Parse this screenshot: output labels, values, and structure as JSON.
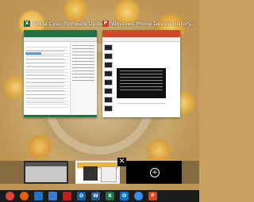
{
  "windows": [
    {
      "title": "Nokia Cyan Firmware Update I...",
      "app_icon": "excel-icon",
      "badge": "X",
      "color": "#217346"
    },
    {
      "title": "Windows Phone Device History...",
      "app_icon": "powerpoint-icon",
      "badge": "P",
      "color": "#d24726"
    }
  ],
  "task_view": {
    "close_glyph": "✕",
    "add_desktop_glyph": "+"
  },
  "taskbar": [
    {
      "name": "chrome-icon",
      "glyph": "",
      "color": "#db4437"
    },
    {
      "name": "firefox-icon",
      "glyph": "",
      "color": "#e66000"
    },
    {
      "name": "photos-icon",
      "glyph": "",
      "color": "#1e73c8"
    },
    {
      "name": "calendar-icon",
      "glyph": "",
      "color": "#3a7bd5"
    },
    {
      "name": "acrobat-icon",
      "glyph": "",
      "color": "#c81c1c"
    },
    {
      "name": "outlook-icon",
      "glyph": "O",
      "color": "#0a64ad"
    },
    {
      "name": "word-icon",
      "glyph": "W",
      "color": "#2b579a"
    },
    {
      "name": "excel-icon",
      "glyph": "X",
      "color": "#217346"
    },
    {
      "name": "onenote-icon",
      "glyph": "O",
      "color": "#0078d7"
    },
    {
      "name": "settings-icon",
      "glyph": "",
      "color": "#3a8ee6"
    },
    {
      "name": "powerpoint-icon",
      "glyph": "P",
      "color": "#d24726"
    }
  ]
}
